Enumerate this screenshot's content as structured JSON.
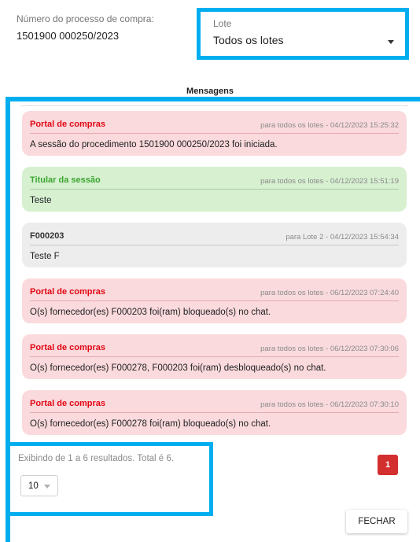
{
  "header": {
    "process_label": "Número do processo de compra:",
    "process_number": "1501900 000250/2023"
  },
  "lote": {
    "label": "Lote",
    "selected": "Todos os lotes"
  },
  "messages_title": "Mensagens",
  "messages": [
    {
      "author": "Portal de compras",
      "meta": "para todos os lotes  -  04/12/2023 15:25:32",
      "text": "A sessão do procedimento 1501900 000250/2023 foi iniciada.",
      "style": "pink"
    },
    {
      "author": "Titular da sessão",
      "meta": "para todos os lotes  -  04/12/2023 15:51:19",
      "text": "Teste",
      "style": "green"
    },
    {
      "author": "F000203",
      "meta": "para Lote 2  -  04/12/2023 15:54:34",
      "text": "Teste F",
      "style": "gray"
    },
    {
      "author": "Portal de compras",
      "meta": "para todos os lotes  -  06/12/2023 07:24:40",
      "text": "O(s) fornecedor(es) F000203 foi(ram) bloqueado(s) no chat.",
      "style": "pink"
    },
    {
      "author": "Portal de compras",
      "meta": "para todos os lotes  -  06/12/2023 07:30:06",
      "text": "O(s) fornecedor(es) F000278, F000203 foi(ram) desbloqueado(s) no chat.",
      "style": "pink"
    },
    {
      "author": "Portal de compras",
      "meta": "para todos os lotes  -  06/12/2023 07:30:10",
      "text": "O(s) fornecedor(es) F000278 foi(ram) bloqueado(s) no chat.",
      "style": "pink"
    }
  ],
  "pagination": {
    "info": "Exibindo de 1 a 6 resultados. Total é 6.",
    "page_size": "10",
    "current_page": "1"
  },
  "buttons": {
    "close": "FECHAR"
  },
  "colors": {
    "highlight": "#00AEEF",
    "portal_author": "#E30613",
    "titular_author": "#3BA52F",
    "active_page": "#D32F2F"
  }
}
